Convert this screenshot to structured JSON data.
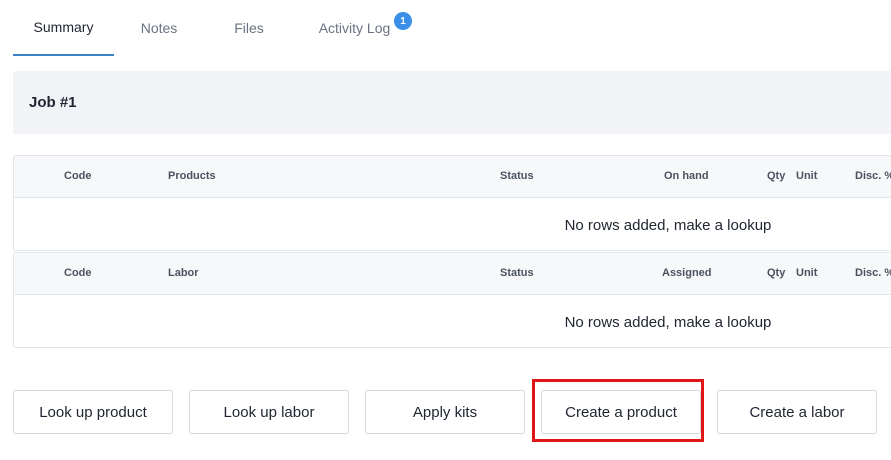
{
  "tabs": [
    {
      "label": "Summary",
      "active": true
    },
    {
      "label": "Notes",
      "active": false
    },
    {
      "label": "Files",
      "active": false
    },
    {
      "label": "Activity Log",
      "active": false,
      "badge": "1"
    }
  ],
  "job": {
    "title": "Job #1"
  },
  "products_table": {
    "headers": {
      "code": "Code",
      "products": "Products",
      "status": "Status",
      "on_hand": "On hand",
      "qty": "Qty",
      "unit": "Unit",
      "disc": "Disc. %"
    },
    "empty_message": "No rows added, make a lookup"
  },
  "labor_table": {
    "headers": {
      "code": "Code",
      "labor": "Labor",
      "status": "Status",
      "assigned": "Assigned",
      "qty": "Qty",
      "unit": "Unit",
      "disc": "Disc. %"
    },
    "empty_message": "No rows added, make a lookup"
  },
  "actions": {
    "look_up_product": "Look up product",
    "look_up_labor": "Look up labor",
    "apply_kits": "Apply kits",
    "create_product": "Create a product",
    "create_labor": "Create a labor"
  },
  "colors": {
    "accent": "#3b82c4",
    "badge": "#3b8fe8",
    "highlight": "#e01515",
    "header_bg": "#f1f3f7"
  }
}
